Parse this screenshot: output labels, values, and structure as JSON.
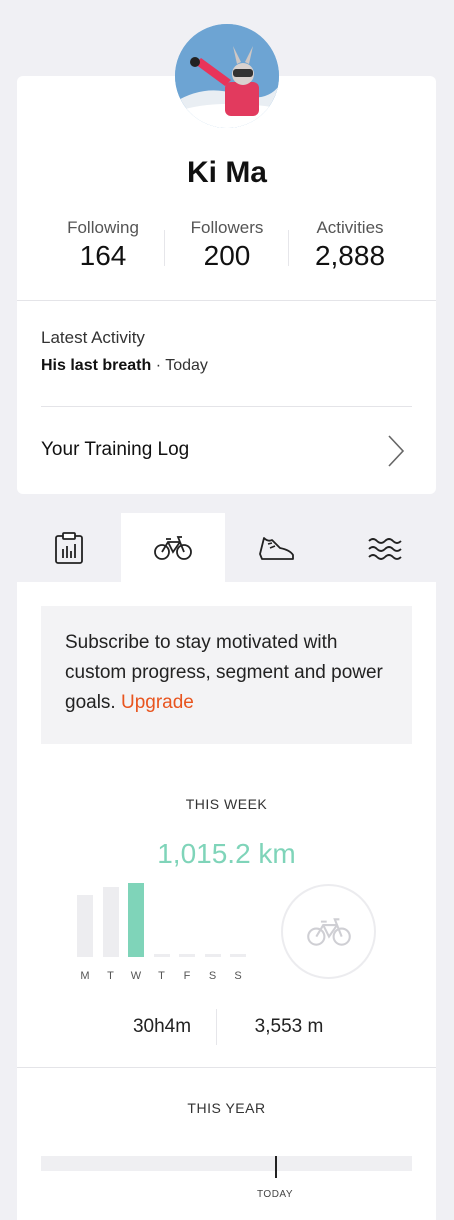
{
  "profile": {
    "name": "Ki Ma",
    "stats": [
      {
        "label": "Following",
        "value": "164"
      },
      {
        "label": "Followers",
        "value": "200"
      },
      {
        "label": "Activities",
        "value": "2,888"
      }
    ]
  },
  "latest": {
    "label": "Latest Activity",
    "activity_name": "His last breath",
    "separator": " · ",
    "when": "Today"
  },
  "training_log": {
    "label": "Your Training Log"
  },
  "tabs": [
    {
      "icon": "clipboard-chart-icon",
      "active": false
    },
    {
      "icon": "bike-icon",
      "active": true
    },
    {
      "icon": "shoe-icon",
      "active": false
    },
    {
      "icon": "waves-icon",
      "active": false
    }
  ],
  "promo": {
    "text": "Subscribe to stay motivated with custom progress, segment and power goals.",
    "link": "Upgrade"
  },
  "this_week": {
    "title": "THIS WEEK",
    "total": "1,015.2 km",
    "days": [
      "M",
      "T",
      "W",
      "T",
      "F",
      "S",
      "S"
    ],
    "day_fill": [
      0.78,
      0.88,
      0.93,
      0,
      0,
      0,
      0
    ],
    "highlight_day": 2,
    "time": "30h4m",
    "elevation": "3,553 m"
  },
  "this_year": {
    "title": "THIS YEAR",
    "progress": 0.63,
    "marker_label": "TODAY"
  },
  "colors": {
    "accent": "#7fd4b9",
    "link": "#e8541e",
    "bar_inactive": "#ededf0"
  }
}
